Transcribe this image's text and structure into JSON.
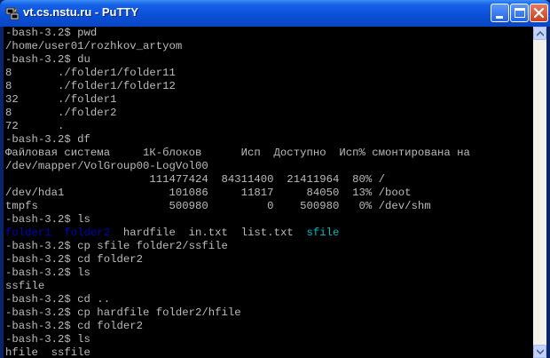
{
  "window": {
    "title": "vt.cs.nstu.ru - PuTTY"
  },
  "colors": {
    "terminal_bg": "#000000",
    "terminal_fg": "#BBBBBB",
    "dir_color": "#0000BB",
    "exec_color": "#00BBBB",
    "titlebar": "#0A4FD6"
  },
  "icons": {
    "app": "putty-icon",
    "minimize": "minimize-icon",
    "maximize": "maximize-icon",
    "close": "close-icon",
    "scroll_up": "scroll-up-arrow-icon",
    "scroll_down": "scroll-down-arrow-icon"
  },
  "terminal": {
    "lines": [
      "-bash-3.2$ pwd",
      "/home/user01/rozhkov_artyom",
      "-bash-3.2$ du",
      "8       ./folder1/folder11",
      "8       ./folder1/folder12",
      "32      ./folder1",
      "8       ./folder2",
      "72      .",
      "-bash-3.2$ df",
      "Файловая система     1К-блоков      Исп  Доступно  Исп% смонтирована на",
      "/dev/mapper/VolGroup00-LogVol00",
      "                      111477424  84311400  21411964  80% /",
      "/dev/hda1                101086     11817     84050  13% /boot",
      "tmpfs                    500980         0    500980   0% /dev/shm",
      "-bash-3.2$ ls"
    ],
    "ls1": {
      "folder1": "folder1",
      "folder2": "folder2",
      "files": "hardfile  in.txt  list.txt",
      "sfile": "sfile"
    },
    "lines2": [
      "-bash-3.2$ cp sfile folder2/ssfile",
      "-bash-3.2$ cd folder2",
      "-bash-3.2$ ls",
      "ssfile",
      "-bash-3.2$ cd ..",
      "-bash-3.2$ cp hardfile folder2/hfile",
      "-bash-3.2$ cd folder2",
      "-bash-3.2$ ls",
      "hfile  ssfile"
    ]
  }
}
